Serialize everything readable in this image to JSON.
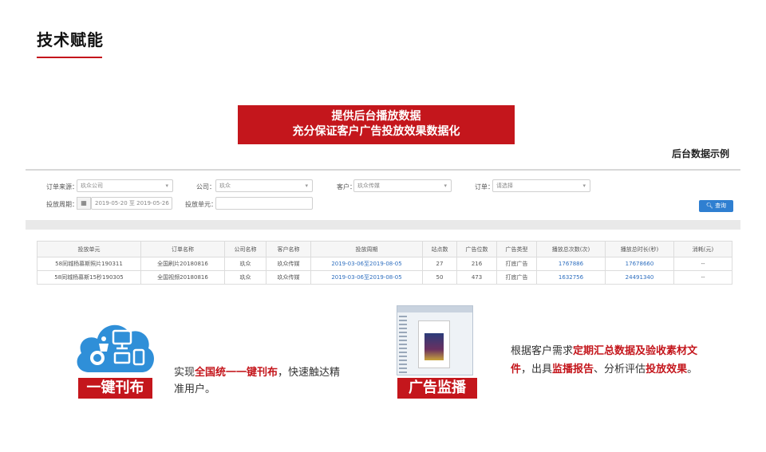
{
  "header": {
    "title": "技术赋能"
  },
  "banner": {
    "line1": "提供后台播放数据",
    "line2": "充分保证客户广告投放效果数据化"
  },
  "caption": "后台数据示例",
  "filters": {
    "order_source_label": "订单来源：",
    "order_source_value": "玖众公司",
    "company_label": "公司：",
    "company_value": "玖众",
    "customer_label": "客户：",
    "customer_value": "玖众传媒",
    "order_label": "订单：",
    "order_placeholder": "请选择",
    "period_label": "投放周期：",
    "period_value": "2019-05-20 至 2019-05-26",
    "unit_label": "投放单元：",
    "unit_value": "",
    "query_label": "查询"
  },
  "table": {
    "headers": [
      "投放单元",
      "订单名称",
      "公司名称",
      "客户名称",
      "投放周期",
      "站点数",
      "广告位数",
      "广告类型",
      "播放总次数(次)",
      "播放总时长(秒)",
      "消耗(元)"
    ],
    "rows": [
      [
        "58同城杨慕斯照片190311",
        "全国刷片20180816",
        "玖众",
        "玖众传媒",
        "2019-03-06至2019-08-05",
        "27",
        "216",
        "打底广告",
        "1767886",
        "17678660",
        "--"
      ],
      [
        "58同城杨慕斯15秒190305",
        "全国视频20180816",
        "玖众",
        "玖众传媒",
        "2019-03-06至2019-08-05",
        "50",
        "473",
        "打底广告",
        "1632756",
        "24491340",
        "--"
      ]
    ]
  },
  "feature1": {
    "tag": "一键刊布",
    "text_pre": "实现",
    "text_highlight": "全国统一一键刊布",
    "text_post": "，快速触达精准用户。"
  },
  "feature2": {
    "tag": "广告监播",
    "text_pre": "根据客户需求",
    "text_highlight1": "定期汇总数据及验收素材文件",
    "text_mid": "，出具",
    "text_highlight2": "监播报告",
    "text_mid2": "、分析评估",
    "text_highlight3": "投放效果",
    "text_post": "。"
  },
  "colors": {
    "accent": "#c4161c",
    "link": "#2f6fbf",
    "button": "#2f7fd1",
    "cloud": "#2f8fd8"
  },
  "icons": [
    "calendar-icon",
    "search-icon",
    "cloud-publish-icon",
    "monitor-screenshot-icon"
  ]
}
